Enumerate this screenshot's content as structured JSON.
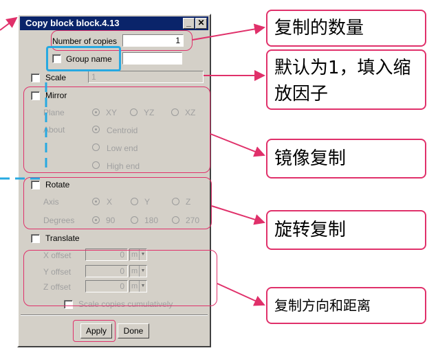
{
  "dialog": {
    "title": "Copy block block.4.13",
    "number_of_copies_label": "Number of copies",
    "number_of_copies_value": "1",
    "group_name_label": "Group name",
    "group_name_value": "",
    "scale_label": "Scale",
    "scale_value": "1",
    "mirror": {
      "label": "Mirror",
      "plane_label": "Plane",
      "plane_options": [
        "XY",
        "YZ",
        "XZ"
      ],
      "plane_selected": "XY",
      "about_label": "About",
      "about_options": [
        "Centroid",
        "Low end",
        "High end"
      ],
      "about_selected": "Centroid"
    },
    "rotate": {
      "label": "Rotate",
      "axis_label": "Axis",
      "axis_options": [
        "X",
        "Y",
        "Z"
      ],
      "axis_selected": "X",
      "degrees_label": "Degrees",
      "degrees_options": [
        "90",
        "180",
        "270"
      ],
      "degrees_selected": "90"
    },
    "translate": {
      "label": "Translate",
      "x_label": "X offset",
      "y_label": "Y offset",
      "z_label": "Z offset",
      "x_value": "0",
      "y_value": "0",
      "z_value": "0",
      "unit": "m",
      "scale_cumulative_label": "Scale copies cumulatively"
    },
    "apply_label": "Apply",
    "done_label": "Done"
  },
  "callouts": {
    "copies": "复制的数量",
    "scale": "默认为1，填入缩放因子",
    "mirror": "镜像复制",
    "rotate": "旋转复制",
    "translate": "复制方向和距离"
  },
  "colors": {
    "title_bar": "#0a246a",
    "dialog_bg": "#d4d0c8",
    "annotation_pink": "#e0306a",
    "annotation_blue": "#27a9e1"
  }
}
